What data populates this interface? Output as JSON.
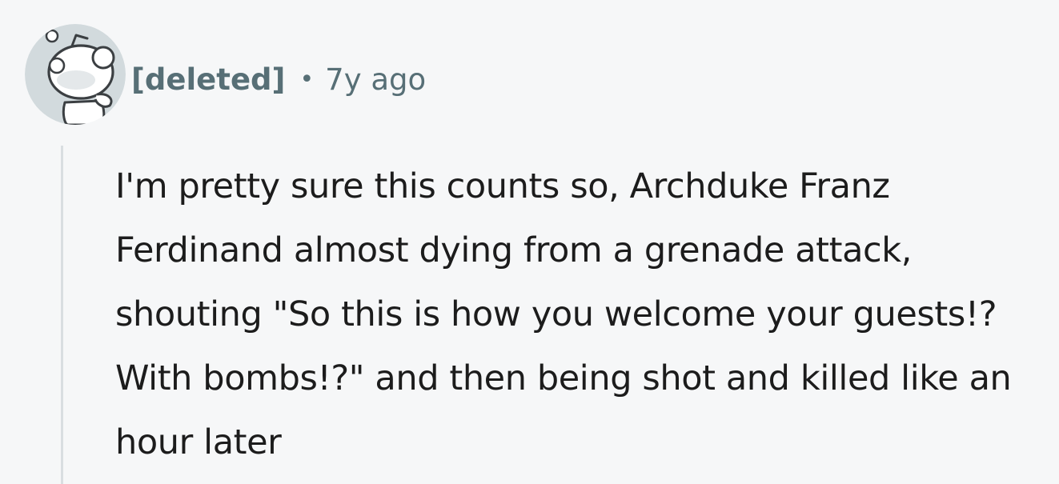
{
  "comment": {
    "author": "[deleted]",
    "separator": "•",
    "age": "7y ago",
    "avatar_icon": "snoo-avatar-icon",
    "body": "I'm pretty sure this counts so, Archduke Franz Ferdinand almost dying from a grenade attack, shouting \"So this is how you welcome your guests!? With bombs!?\" and then being shot and killed like an hour later"
  },
  "colors": {
    "background": "#f6f7f8",
    "meta_text": "#576f76",
    "body_text": "#1c1c1c",
    "thread_line": "#d9dee1",
    "avatar_bg": "#d2dadd"
  }
}
